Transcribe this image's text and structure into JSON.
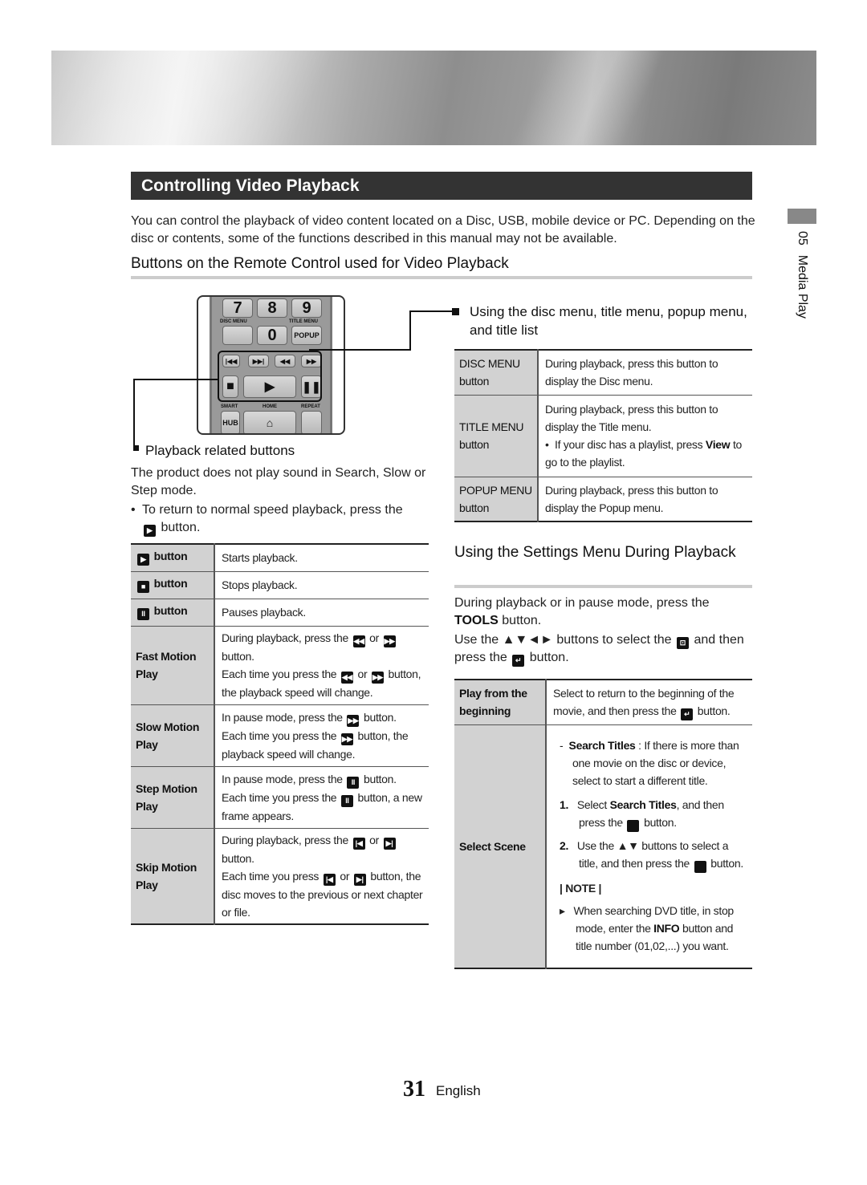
{
  "section_title": "Controlling Video Playback",
  "intro": "You can control the playback of video content located on a Disc, USB, mobile device or PC. Depending on the disc or contents, some of the functions described in this manual may not be available.",
  "subsection_title": "Buttons on the Remote Control used for Video Playback",
  "side_tab": {
    "chapter": "05",
    "title": "Media Play"
  },
  "remote": {
    "keys": [
      "7",
      "8",
      "9",
      "0",
      "POPUP",
      "HUB"
    ],
    "labels": {
      "disc_menu": "DISC MENU",
      "title_menu": "TITLE MENU",
      "smart": "SMART",
      "home": "HOME",
      "repeat": "REPEAT"
    },
    "icons": {
      "prev": "skip-back-icon",
      "next": "skip-forward-icon",
      "rew": "rewind-icon",
      "ff": "fast-forward-icon",
      "stop": "stop-icon",
      "play": "play-icon",
      "pause": "pause-icon",
      "home": "home-icon"
    }
  },
  "playback_section": {
    "heading": "Playback related buttons",
    "note": "The product does not play sound in Search, Slow or Step mode.",
    "bullet_pre": "To return to normal speed playback, press the",
    "bullet_post": "button.",
    "rows": [
      {
        "key_icon": "play-icon",
        "key": "button",
        "value": "Starts playback."
      },
      {
        "key_icon": "stop-icon",
        "key": "button",
        "value": "Stops playback."
      },
      {
        "key_icon": "pause-icon",
        "key": "button",
        "value": "Pauses playback."
      }
    ],
    "fast_motion": {
      "key": "Fast Motion Play",
      "l1a": "During playback, press the",
      "or": "or",
      "l1b": "button.",
      "l2a": "Each time you press the",
      "l2b": "button, the playback speed will change."
    },
    "slow_motion": {
      "key": "Slow Motion Play",
      "l1a": "In pause mode, press the",
      "l1b": "button.",
      "l2a": "Each time you press the",
      "l2b": "button, the playback speed will change."
    },
    "step_motion": {
      "key": "Step Motion Play",
      "l1a": "In pause mode, press the",
      "l1b": "button.",
      "l2a": "Each time you press the",
      "l2b": "button, a new frame appears."
    },
    "skip_motion": {
      "key": "Skip Motion Play",
      "l1a": "During playback, press the",
      "or": "or",
      "l1b": "button.",
      "l2a": "Each time you press",
      "l2b": "button, the disc moves to the previous or next chapter or file."
    }
  },
  "menu_section": {
    "heading": "Using the disc menu, title menu, popup menu, and title list",
    "disc_menu": {
      "key1": "DISC MENU",
      "key2": "button",
      "value": "During playback, press this button to display the Disc menu."
    },
    "title_menu": {
      "key1": "TITLE MENU",
      "key2": "button",
      "value": "During playback, press this button to display the Title menu.",
      "bullet_pre": "If your disc has a playlist, press",
      "bullet_bold": "View",
      "bullet_post": "to go to the playlist."
    },
    "popup_menu": {
      "key1": "POPUP MENU",
      "key2": "button",
      "value": "During playback, press this button to display the Popup menu."
    }
  },
  "settings_section": {
    "heading": "Using the Settings Menu During Playback",
    "p1_pre": "During playback or in pause mode, press the",
    "p1_bold": "TOOLS",
    "p1_post": "button.",
    "p2_a": "Use the ▲▼◄► buttons to select the",
    "p2_b": "and then press the",
    "p2_c": "button.",
    "play_from_beginning": {
      "key": "Play from the beginning",
      "value_pre": "Select to return to the beginning of the movie, and then press the",
      "value_post": "button."
    },
    "select_scene": {
      "key": "Select Scene",
      "dash_bold": "Search Titles",
      "dash_text": ": If there is more than one movie on the disc or device, select to start a different title.",
      "step1_num": "1.",
      "step1_pre": "Select",
      "step1_bold": "Search Titles",
      "step1_mid": ", and then press the",
      "step1_post": "button.",
      "step2_num": "2.",
      "step2_pre": "Use the ▲▼ buttons to select a title, and then press the",
      "step2_post": "button.",
      "note_label": "| NOTE |",
      "note_pre": "When searching DVD title, in stop mode, enter the",
      "note_bold": "INFO",
      "note_post": "button and title number (01,02,...) you want."
    }
  },
  "footer": {
    "page_number": "31",
    "language": "English"
  }
}
